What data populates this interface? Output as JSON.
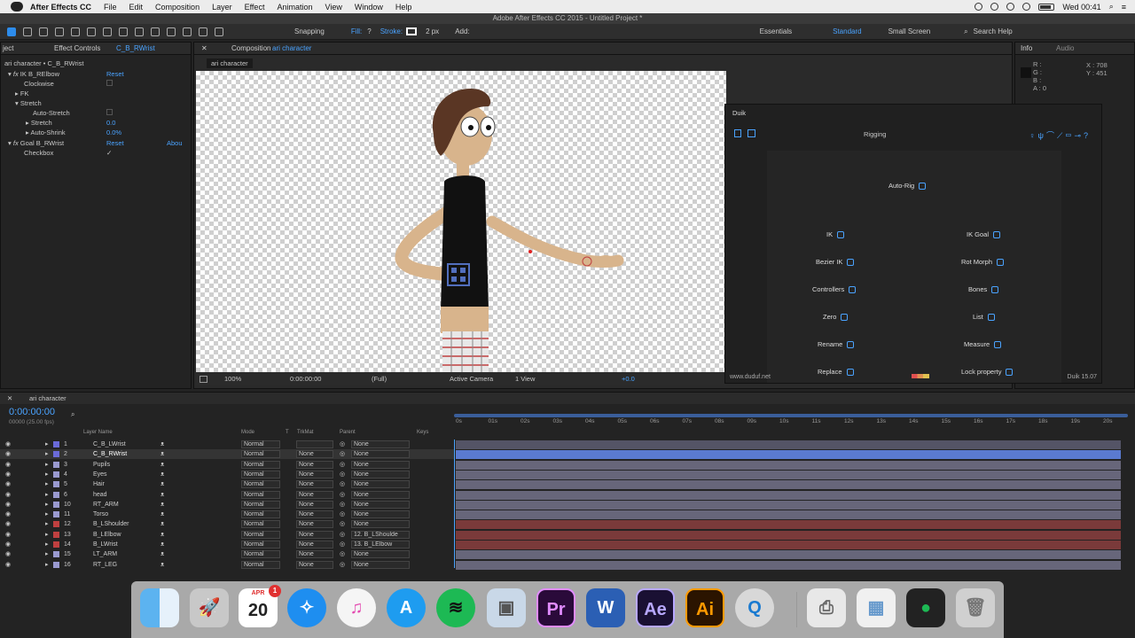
{
  "menubar": {
    "app": "After Effects CC",
    "items": [
      "File",
      "Edit",
      "Composition",
      "Layer",
      "Effect",
      "Animation",
      "View",
      "Window",
      "Help"
    ],
    "clock": "Wed 00:41"
  },
  "window_title": "Adobe After Effects CC 2015 - Untitled Project *",
  "toolbar": {
    "snapping": "Snapping",
    "fill": "Fill:",
    "fill_value": "?",
    "stroke": "Stroke:",
    "stroke_width": "2 px",
    "add": "Add:",
    "workspaces": [
      "Essentials",
      "Standard",
      "Small Screen"
    ],
    "search": "Search Help"
  },
  "effect_controls": {
    "tab_left": "ject",
    "tab": "Effect Controls",
    "tab_layer": "C_B_RWrist",
    "path": "ari character • C_B_RWrist",
    "rows": [
      {
        "label": "IK B_RElbow",
        "value": "Reset"
      },
      {
        "label": "Clockwise",
        "value": ""
      },
      {
        "label": "FK",
        "value": ""
      },
      {
        "label": "Stretch",
        "value": ""
      },
      {
        "label": "Auto-Stretch",
        "value": ""
      },
      {
        "label": "Stretch",
        "value": "0.0"
      },
      {
        "label": "Auto-Shrink",
        "value": "0.0%"
      },
      {
        "label": "Goal B_RWrist",
        "value": "Reset"
      },
      {
        "label": "Checkbox",
        "value": "✓"
      }
    ],
    "about": "Abou"
  },
  "composition": {
    "tab": "Composition",
    "tab_name": "ari character",
    "subtab": "ari character",
    "footer": {
      "zoom": "100%",
      "time": "0:00:00:00",
      "resolution": "(Full)",
      "camera": "Active Camera",
      "views": "1 View",
      "exposure": "+0.0"
    }
  },
  "info": {
    "tab": "Info",
    "tab2": "Audio",
    "r": "R :",
    "g": "G :",
    "b": "B :",
    "a": "A : 0",
    "x": "X : 708",
    "y": "Y : 451"
  },
  "duik": {
    "title": "Duik",
    "section": "Rigging",
    "autorig": "Auto-Rig",
    "buttons": [
      [
        "IK",
        "IK Goal"
      ],
      [
        "Bezier IK",
        "Rot Morph"
      ],
      [
        "Controllers",
        "Bones"
      ],
      [
        "Zero",
        "List"
      ],
      [
        "Rename",
        "Measure"
      ],
      [
        "Replace",
        "Lock property"
      ]
    ],
    "url": "www.duduf.net",
    "version": "Duik 15.07"
  },
  "timeline": {
    "tab": "ari character",
    "timecode": "0:00:00:00",
    "fps": "00000 (25.00 fps)",
    "headers": {
      "layer_name": "Layer Name",
      "mode": "Mode",
      "t": "T",
      "trkmat": "TrkMat",
      "parent": "Parent",
      "keys": "Keys"
    },
    "ruler": [
      "0s",
      "01s",
      "02s",
      "03s",
      "04s",
      "05s",
      "06s",
      "07s",
      "08s",
      "09s",
      "10s",
      "11s",
      "12s",
      "13s",
      "14s",
      "15s",
      "16s",
      "17s",
      "18s",
      "19s",
      "20s"
    ],
    "layers": [
      {
        "num": "1",
        "name": "C_B_LWrist",
        "color": "#6a6ad8",
        "mode": "Normal",
        "trkmat": "",
        "parent": "None",
        "bar": "#545466"
      },
      {
        "num": "2",
        "name": "C_B_RWrist",
        "color": "#6a6ad8",
        "mode": "Normal",
        "trkmat": "None",
        "parent": "None",
        "bar": "#5a7ad0"
      },
      {
        "num": "3",
        "name": "Pupils",
        "color": "#9a9ad0",
        "mode": "Normal",
        "trkmat": "None",
        "parent": "None",
        "bar": "#67667a"
      },
      {
        "num": "4",
        "name": "Eyes",
        "color": "#9a9ad0",
        "mode": "Normal",
        "trkmat": "None",
        "parent": "None",
        "bar": "#67667a"
      },
      {
        "num": "5",
        "name": "Hair",
        "color": "#9a9ad0",
        "mode": "Normal",
        "trkmat": "None",
        "parent": "None",
        "bar": "#67667a"
      },
      {
        "num": "6",
        "name": "head",
        "color": "#9a9ad0",
        "mode": "Normal",
        "trkmat": "None",
        "parent": "None",
        "bar": "#67667a"
      },
      {
        "num": "10",
        "name": "RT_ARM",
        "color": "#9a9ad0",
        "mode": "Normal",
        "trkmat": "None",
        "parent": "None",
        "bar": "#67667a"
      },
      {
        "num": "11",
        "name": "Torso",
        "color": "#9a9ad0",
        "mode": "Normal",
        "trkmat": "None",
        "parent": "None",
        "bar": "#67667a"
      },
      {
        "num": "12",
        "name": "B_LShoulder",
        "color": "#c04040",
        "mode": "Normal",
        "trkmat": "None",
        "parent": "None",
        "bar": "#7a3a3a"
      },
      {
        "num": "13",
        "name": "B_LElbow",
        "color": "#c04040",
        "mode": "Normal",
        "trkmat": "None",
        "parent": "12. B_LShoulde",
        "bar": "#7a3a3a"
      },
      {
        "num": "14",
        "name": "B_LWrist",
        "color": "#c04040",
        "mode": "Normal",
        "trkmat": "None",
        "parent": "13. B_LElbow",
        "bar": "#7a3a3a"
      },
      {
        "num": "15",
        "name": "LT_ARM",
        "color": "#9a9ad0",
        "mode": "Normal",
        "trkmat": "None",
        "parent": "None",
        "bar": "#67667a"
      },
      {
        "num": "16",
        "name": "RT_LEG",
        "color": "#9a9ad0",
        "mode": "Normal",
        "trkmat": "None",
        "parent": "None",
        "bar": "#67667a"
      }
    ]
  },
  "dock": {
    "calendar_month": "APR",
    "calendar_day": "20",
    "calendar_badge": "1",
    "apps": [
      "finder-icon",
      "launchpad-icon",
      "calendar-icon",
      "safari-icon",
      "itunes-icon",
      "app-store-icon",
      "spotify-icon",
      "preview-icon",
      "premiere-icon",
      "word-icon",
      "after-effects-icon",
      "illustrator-icon",
      "quicktime-icon",
      "printer-icon",
      "screenshot-icon",
      "terminal-icon",
      "trash-icon"
    ],
    "labels": {
      "premiere": "Pr",
      "word": "W",
      "after_effects": "Ae",
      "illustrator": "Ai"
    }
  }
}
